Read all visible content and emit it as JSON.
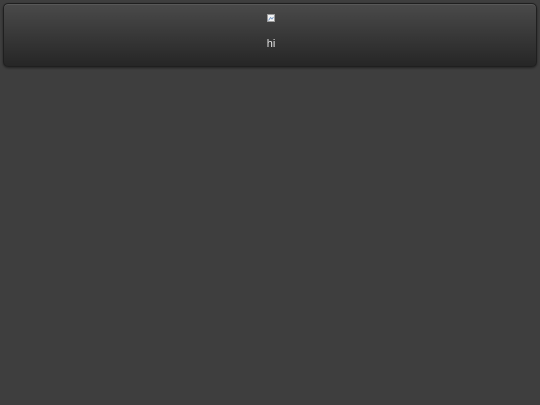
{
  "header": {
    "image_icon": "broken-image-icon",
    "greeting_text": "hi"
  },
  "colors": {
    "background": "#3e3e3e",
    "header_top": "#4a4a4a",
    "header_bottom": "#262626",
    "text": "#e6e6e6"
  }
}
